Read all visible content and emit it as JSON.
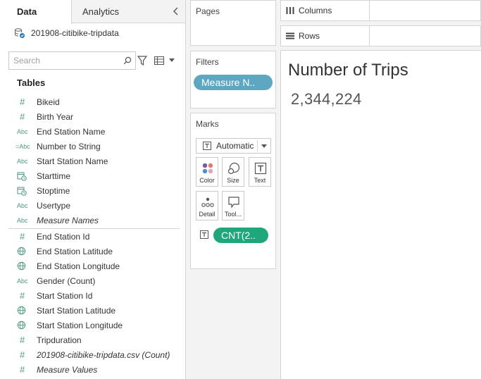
{
  "data_pane": {
    "tabs": [
      {
        "label": "Data",
        "active": true
      },
      {
        "label": "Analytics",
        "active": false
      }
    ],
    "datasource_name": "201908-citibike-tripdata",
    "search_placeholder": "Search",
    "tables_heading": "Tables",
    "dimensions": [
      {
        "type": "#",
        "name": "Bikeid"
      },
      {
        "type": "#",
        "name": "Birth Year"
      },
      {
        "type": "Abc",
        "name": "End Station Name"
      },
      {
        "type": "=Abc",
        "name": "Number to String"
      },
      {
        "type": "Abc",
        "name": "Start Station Name"
      },
      {
        "type": "calendar-clock-icon",
        "name": "Starttime"
      },
      {
        "type": "calendar-clock-icon",
        "name": "Stoptime"
      },
      {
        "type": "Abc",
        "name": "Usertype"
      },
      {
        "type": "Abc",
        "name": "Measure Names"
      }
    ],
    "measures": [
      {
        "type": "#",
        "name": "End Station Id"
      },
      {
        "type": "globe-icon",
        "name": "End Station Latitude"
      },
      {
        "type": "globe-icon",
        "name": "End Station Longitude"
      },
      {
        "type": "Abc",
        "name": "Gender (Count)"
      },
      {
        "type": "#",
        "name": "Start Station Id"
      },
      {
        "type": "globe-icon",
        "name": "Start Station Latitude"
      },
      {
        "type": "globe-icon",
        "name": "Start Station Longitude"
      },
      {
        "type": "#",
        "name": "Tripduration"
      },
      {
        "type": "#",
        "name": "201908-citibike-tripdata.csv (Count)"
      },
      {
        "type": "#",
        "name": "Measure Values"
      }
    ]
  },
  "cards": {
    "pages_title": "Pages",
    "filters_title": "Filters",
    "filter_pill": "Measure N..",
    "marks_title": "Marks",
    "mark_type": "Automatic",
    "mark_buttons": {
      "color": "Color",
      "size": "Size",
      "text": "Text",
      "detail": "Detail",
      "tooltip": "Tool..."
    },
    "measure_pill": "CNT(2.."
  },
  "shelves": {
    "columns_label": "Columns",
    "rows_label": "Rows"
  },
  "view": {
    "title": "Number of Trips",
    "value": "2,344,224"
  },
  "colors": {
    "filter_pill": "#5ea7c1",
    "measure_pill": "#1fa67a",
    "field_icon": "#4a9a7d"
  }
}
